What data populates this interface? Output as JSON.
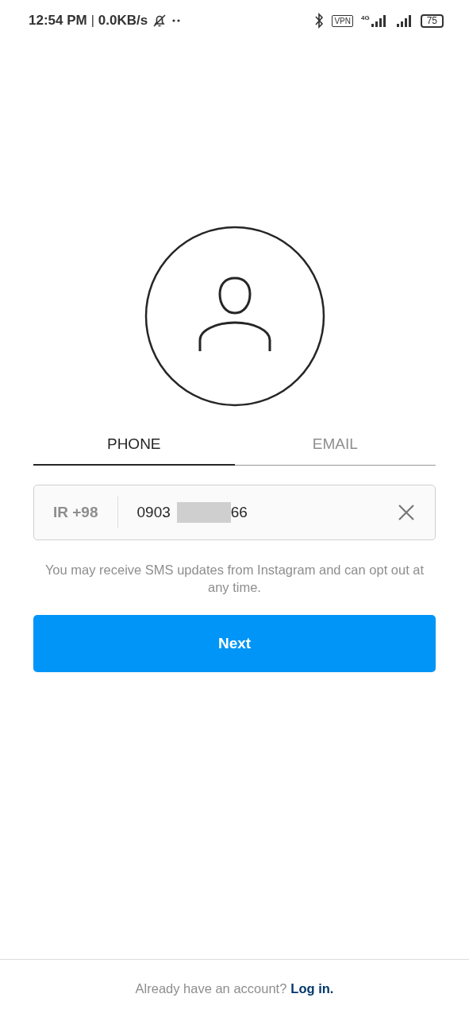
{
  "status_bar": {
    "time": "12:54 PM",
    "separator": "|",
    "speed": "0.0KB/s",
    "vpn": "VPN",
    "network": "4G",
    "battery": "75"
  },
  "tabs": [
    {
      "label": "PHONE",
      "selected": true
    },
    {
      "label": "EMAIL",
      "selected": false
    }
  ],
  "phone_field": {
    "country_code": "IR +98",
    "value_start": "0903",
    "redacted": true,
    "value_end": "66"
  },
  "notice": "You may receive SMS updates from Instagram and can opt out at any time.",
  "next_button": "Next",
  "footer": {
    "text": "Already have an account?",
    "link": "Log in."
  }
}
